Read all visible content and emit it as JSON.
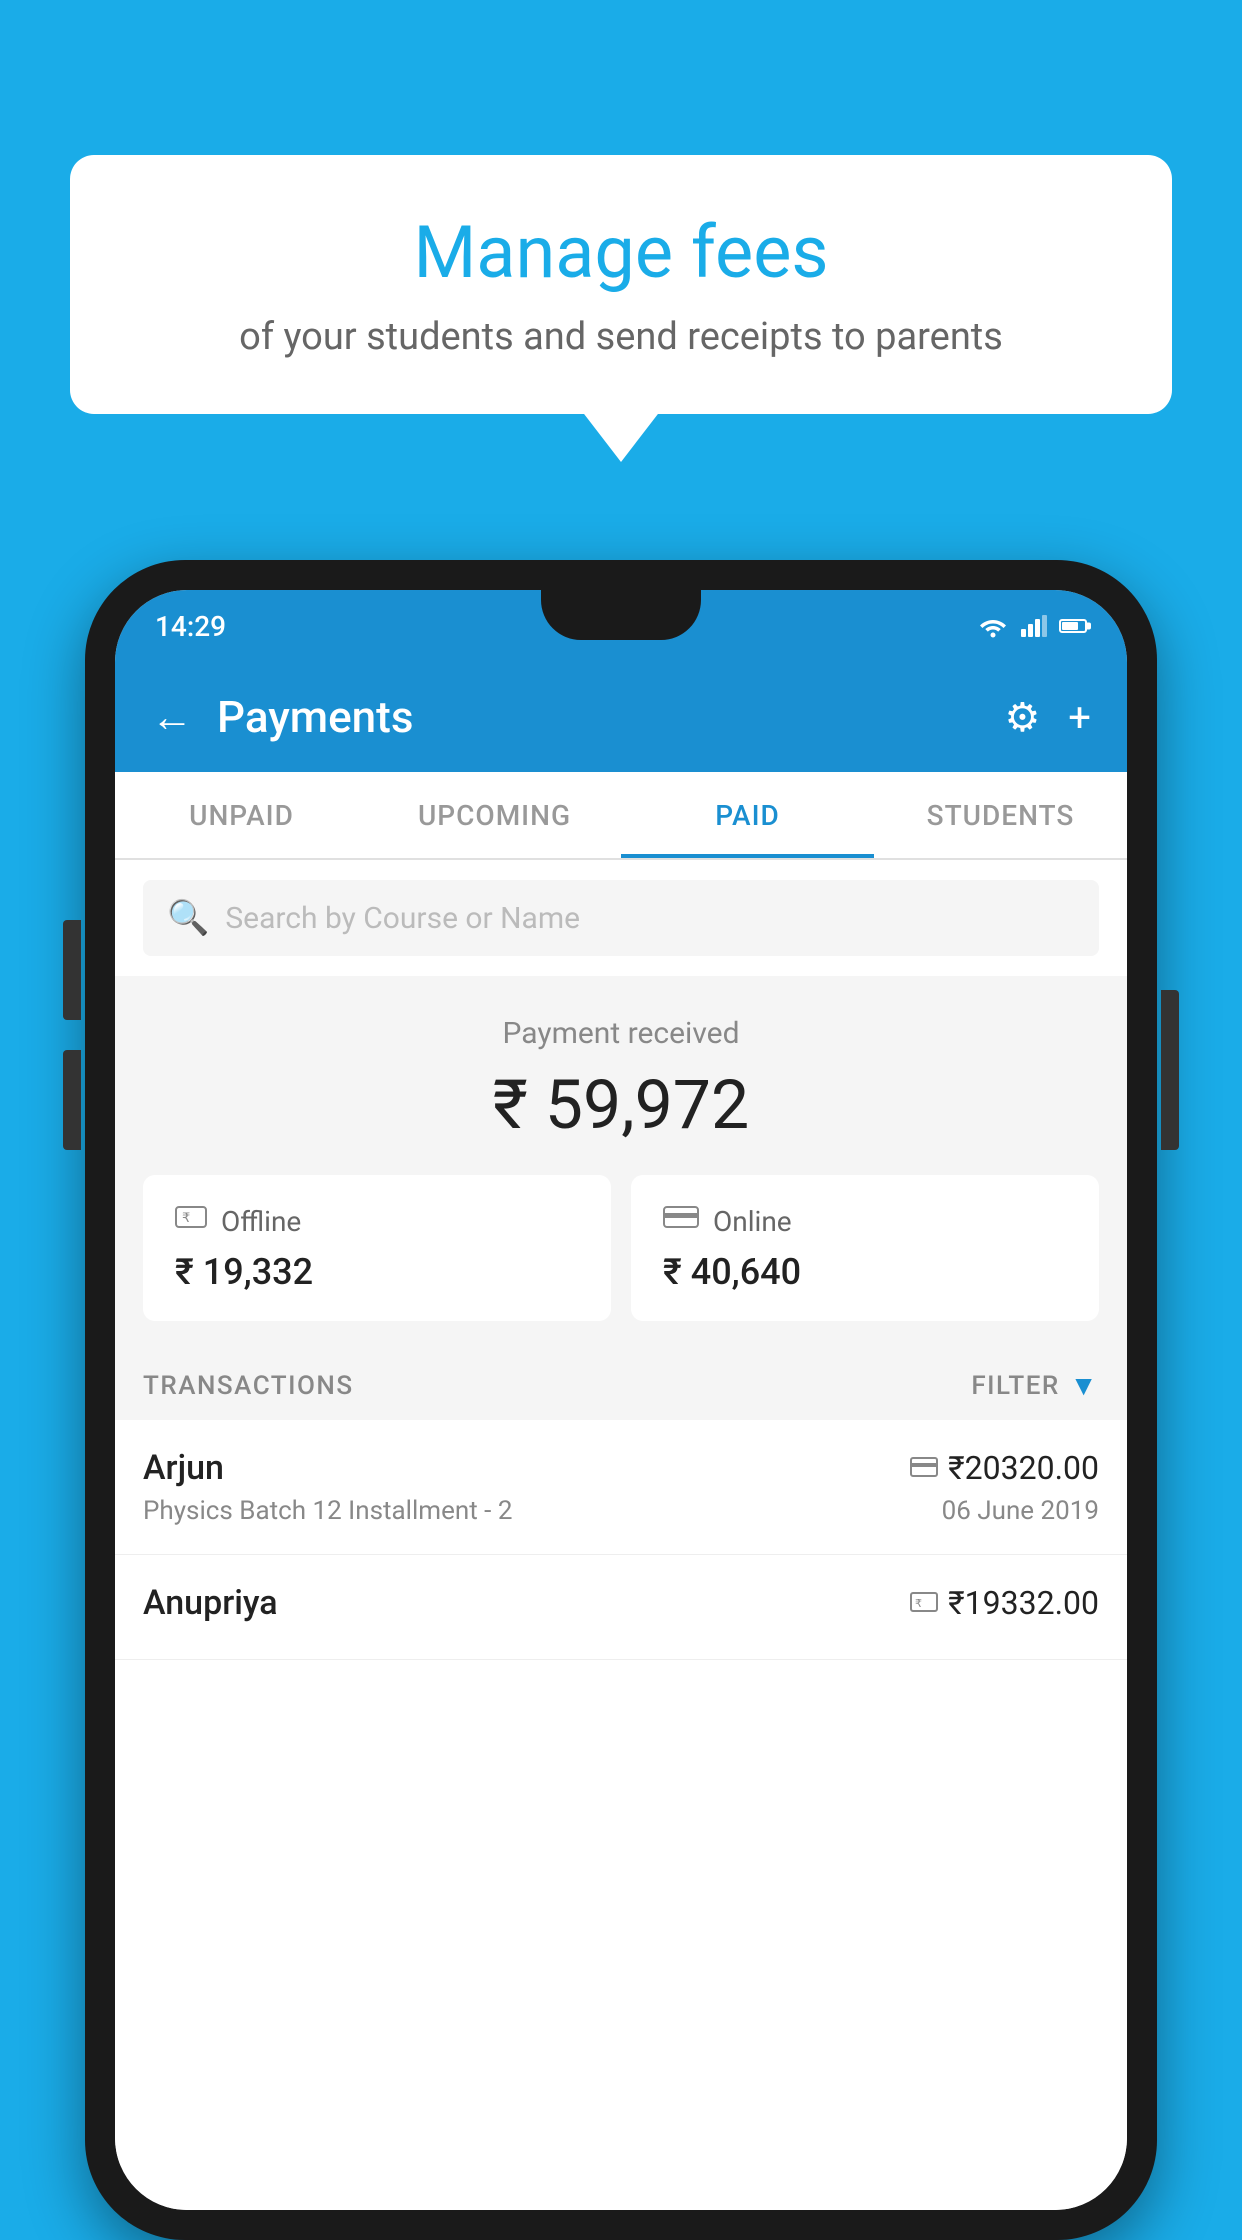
{
  "background_color": "#1AACE8",
  "bubble": {
    "title": "Manage fees",
    "subtitle": "of your students and send receipts to parents"
  },
  "phone": {
    "status_bar": {
      "time": "14:29"
    },
    "app_bar": {
      "title": "Payments",
      "back_label": "←",
      "settings_label": "⚙",
      "add_label": "+"
    },
    "tabs": [
      {
        "label": "UNPAID",
        "active": false
      },
      {
        "label": "UPCOMING",
        "active": false
      },
      {
        "label": "PAID",
        "active": true
      },
      {
        "label": "STUDENTS",
        "active": false
      }
    ],
    "search": {
      "placeholder": "Search by Course or Name"
    },
    "payment_summary": {
      "label": "Payment received",
      "amount": "₹ 59,972",
      "offline": {
        "label": "Offline",
        "amount": "₹ 19,332"
      },
      "online": {
        "label": "Online",
        "amount": "₹ 40,640"
      }
    },
    "transactions": {
      "section_label": "TRANSACTIONS",
      "filter_label": "FILTER",
      "items": [
        {
          "name": "Arjun",
          "desc": "Physics Batch 12 Installment - 2",
          "amount": "₹20320.00",
          "date": "06 June 2019",
          "payment_type": "online"
        },
        {
          "name": "Anupriya",
          "desc": "",
          "amount": "₹19332.00",
          "date": "",
          "payment_type": "offline"
        }
      ]
    }
  }
}
